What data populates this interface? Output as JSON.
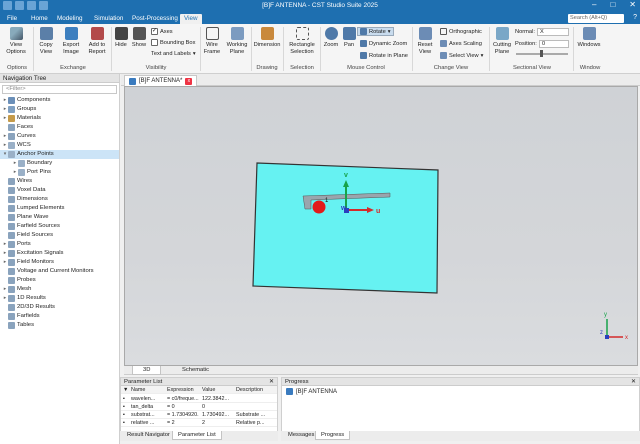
{
  "window": {
    "title": "[B]F ANTENNA - CST Studio Suite 2025",
    "minimize": "–",
    "maximize": "□",
    "close": "✕"
  },
  "menu": {
    "items": [
      "File",
      "Home",
      "Modeling",
      "Simulation",
      "Post-Processing",
      "View"
    ],
    "active_index": 5,
    "search_placeholder": "Search (Alt+Q)",
    "help": "?"
  },
  "ribbon": {
    "options": {
      "view_options": "View\nOptions",
      "group": "Options"
    },
    "exchange": {
      "copy_view": "Copy\nView",
      "export_image": "Export\nImage",
      "add_to_report": "Add to\nReport",
      "group": "Exchange"
    },
    "visibility": {
      "hide": "Hide",
      "show": "Show",
      "axes": "Axes",
      "bounding_box": "Bounding Box",
      "text_and_labels": "Text and Labels",
      "group": "Visibility"
    },
    "wire_frame": "Wire\nFrame",
    "working_plane": "Working\nPlane",
    "drawing": {
      "dimension": "Dimension",
      "group": "Drawing"
    },
    "selection": {
      "rectangle_selection": "Rectangle\nSelection",
      "group": "Selection"
    },
    "mouse_control": {
      "zoom": "Zoom",
      "pan": "Pan",
      "rotate": "Rotate",
      "dynamic_zoom": "Dynamic Zoom",
      "rotate_in_plane": "Rotate in Plane",
      "group": "Mouse Control"
    },
    "change_view": {
      "reset_view": "Reset\nView",
      "orthographic": "Orthographic",
      "axes_scaling": "Axes Scaling",
      "select_view": "Select View",
      "group": "Change View"
    },
    "sectional_view": {
      "cutting_plane": "Cutting\nPlane",
      "normal_label": "Normal:",
      "normal_value": "X",
      "position_label": "Position:",
      "position_value": "0",
      "group": "Sectional View"
    },
    "window": {
      "windows": "Windows",
      "group": "Window"
    }
  },
  "nav": {
    "title": "Navigation Tree",
    "filter_placeholder": "<Filter>",
    "items": [
      {
        "label": "Components",
        "expander": "▸",
        "color": "#6b8fb8"
      },
      {
        "label": "Groups",
        "expander": "▸",
        "color": "#7fa0c2"
      },
      {
        "label": "Materials",
        "expander": "▸",
        "color": "#c59b4a"
      },
      {
        "label": "Faces",
        "expander": "",
        "color": "#8aa3bd"
      },
      {
        "label": "Curves",
        "expander": "▸",
        "color": "#8aa3bd"
      },
      {
        "label": "WCS",
        "expander": "▸",
        "color": "#9ab0c7"
      },
      {
        "label": "Anchor Points",
        "expander": "▾",
        "color": "#9ab0c7"
      },
      {
        "label": "Boundary",
        "expander": "▸",
        "color": "#9ab0c7",
        "indent": 1
      },
      {
        "label": "Port Pins",
        "expander": "▸",
        "color": "#9ab0c7",
        "indent": 1
      },
      {
        "label": "Wires",
        "expander": "",
        "color": "#8aa3bd"
      },
      {
        "label": "Voxel Data",
        "expander": "",
        "color": "#8aa3bd"
      },
      {
        "label": "Dimensions",
        "expander": "",
        "color": "#8aa3bd"
      },
      {
        "label": "Lumped Elements",
        "expander": "",
        "color": "#8aa3bd"
      },
      {
        "label": "Plane Wave",
        "expander": "",
        "color": "#8aa3bd"
      },
      {
        "label": "Farfield Sources",
        "expander": "",
        "color": "#8aa3bd"
      },
      {
        "label": "Field Sources",
        "expander": "",
        "color": "#8aa3bd"
      },
      {
        "label": "Ports",
        "expander": "▸",
        "color": "#8aa3bd"
      },
      {
        "label": "Excitation Signals",
        "expander": "▸",
        "color": "#8aa3bd"
      },
      {
        "label": "Field Monitors",
        "expander": "▸",
        "color": "#8aa3bd"
      },
      {
        "label": "Voltage and Current Monitors",
        "expander": "",
        "color": "#8aa3bd"
      },
      {
        "label": "Probes",
        "expander": "",
        "color": "#8aa3bd"
      },
      {
        "label": "Mesh",
        "expander": "▸",
        "color": "#8aa3bd"
      },
      {
        "label": "1D Results",
        "expander": "▸",
        "color": "#8aa3bd"
      },
      {
        "label": "2D/3D Results",
        "expander": "",
        "color": "#8aa3bd"
      },
      {
        "label": "Farfields",
        "expander": "",
        "color": "#8aa3bd"
      },
      {
        "label": "Tables",
        "expander": "",
        "color": "#8aa3bd"
      }
    ],
    "selected_index": 6
  },
  "document_tab": {
    "label": "[B]F ANTENNA*",
    "close": "x"
  },
  "viewport": {
    "axis_v": "v",
    "axis_w": "w",
    "axis_u": "u",
    "port_number": "1",
    "triad_x": "x",
    "triad_y": "y",
    "triad_z": "z"
  },
  "view_tabs": [
    "3D",
    "Schematic"
  ],
  "param_list": {
    "title": "Parameter List",
    "columns": [
      "Name",
      "Expression",
      "Value",
      "Description"
    ],
    "rows": [
      {
        "name": "wavelen...",
        "expr": "= c0/freque...",
        "value": "122.3842...",
        "desc": ""
      },
      {
        "name": "tan_delta",
        "expr": "= 0",
        "value": "0",
        "desc": ""
      },
      {
        "name": "substrat...",
        "expr": "= 1.7304920...",
        "value": "1.730492...",
        "desc": "Substrate ..."
      },
      {
        "name": "relative ...",
        "expr": "= 2",
        "value": "2",
        "desc": "Relative p..."
      }
    ],
    "bottom_tabs": [
      "Result Navigator",
      "Parameter List"
    ],
    "active_tab": 1
  },
  "progress": {
    "title": "Progress",
    "entry": "[B]F ANTENNA",
    "bottom_tabs": [
      "Messages",
      "Progress"
    ],
    "active_tab": 1
  },
  "colors": {
    "brand": "#1e6fb0",
    "substrate": "#66f2f2",
    "selection": "#cce4f7",
    "port": "#e21b1b"
  }
}
